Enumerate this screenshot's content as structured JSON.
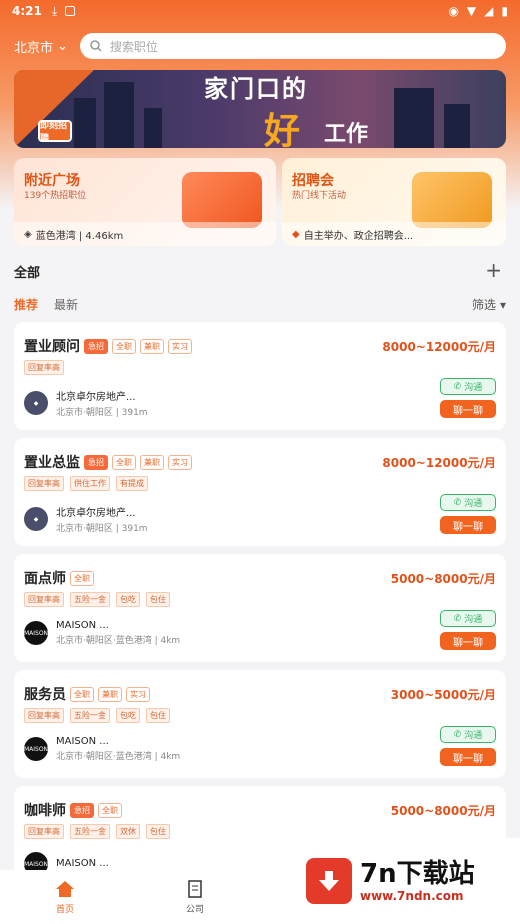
{
  "status": {
    "time": "4:21"
  },
  "header": {
    "city": "北京市",
    "search_placeholder": "搜索职位"
  },
  "banner": {
    "badge": "即刻招聘",
    "line1": "家门口的",
    "line2": "好",
    "line3": "工作"
  },
  "cards": [
    {
      "title": "附近广场",
      "subtitle": "139个热招职位",
      "footer": "蓝色港湾 | 4.46km"
    },
    {
      "title": "招聘会",
      "subtitle": "热门线下活动",
      "footer": "自主举办、政企招聘会..."
    }
  ],
  "filter_bar": {
    "all": "全部",
    "tab_recommend": "推荐",
    "tab_latest": "最新",
    "filter": "筛选"
  },
  "jobs": [
    {
      "title": "置业顾问",
      "tags": [
        "急招",
        "全职",
        "兼职",
        "实习"
      ],
      "salary": "8000~12000元/月",
      "welfare": [
        "回复率高"
      ],
      "company": "北京卓尔房地产...",
      "location": "北京市·朝阳区 | 391m",
      "talk": "沟通",
      "chat": "聊一聊"
    },
    {
      "title": "置业总监",
      "tags": [
        "急招",
        "全职",
        "兼职",
        "实习"
      ],
      "salary": "8000~12000元/月",
      "welfare": [
        "回复率高",
        "供住工作",
        "有提成"
      ],
      "company": "北京卓尔房地产...",
      "location": "北京市·朝阳区 | 391m",
      "talk": "沟通",
      "chat": "聊一聊"
    },
    {
      "title": "面点师",
      "tags": [
        "全职"
      ],
      "salary": "5000~8000元/月",
      "welfare": [
        "回复率高",
        "五险一金",
        "包吃",
        "包住"
      ],
      "company": "MAISON ...",
      "location": "北京市·朝阳区·蓝色港湾 | 4km",
      "talk": "沟通",
      "chat": "聊一聊"
    },
    {
      "title": "服务员",
      "tags": [
        "全职",
        "兼职",
        "实习"
      ],
      "salary": "3000~5000元/月",
      "welfare": [
        "回复率高",
        "五险一金",
        "包吃",
        "包住"
      ],
      "company": "MAISON ...",
      "location": "北京市·朝阳区·蓝色港湾 | 4km",
      "talk": "沟通",
      "chat": "聊一聊"
    },
    {
      "title": "咖啡师",
      "tags": [
        "急招",
        "全职"
      ],
      "salary": "5000~8000元/月",
      "welfare": [
        "回复率高",
        "五险一金",
        "双休",
        "包住"
      ],
      "company": "MAISON ...",
      "location": "",
      "talk": "",
      "chat": ""
    }
  ],
  "nav": {
    "home": "首页",
    "company": "公司"
  },
  "watermark": {
    "title": "7n下载站",
    "url": "www.7ndn.com"
  },
  "colors": {
    "accent": "#f06a27",
    "talk_green": "#39b66a"
  }
}
